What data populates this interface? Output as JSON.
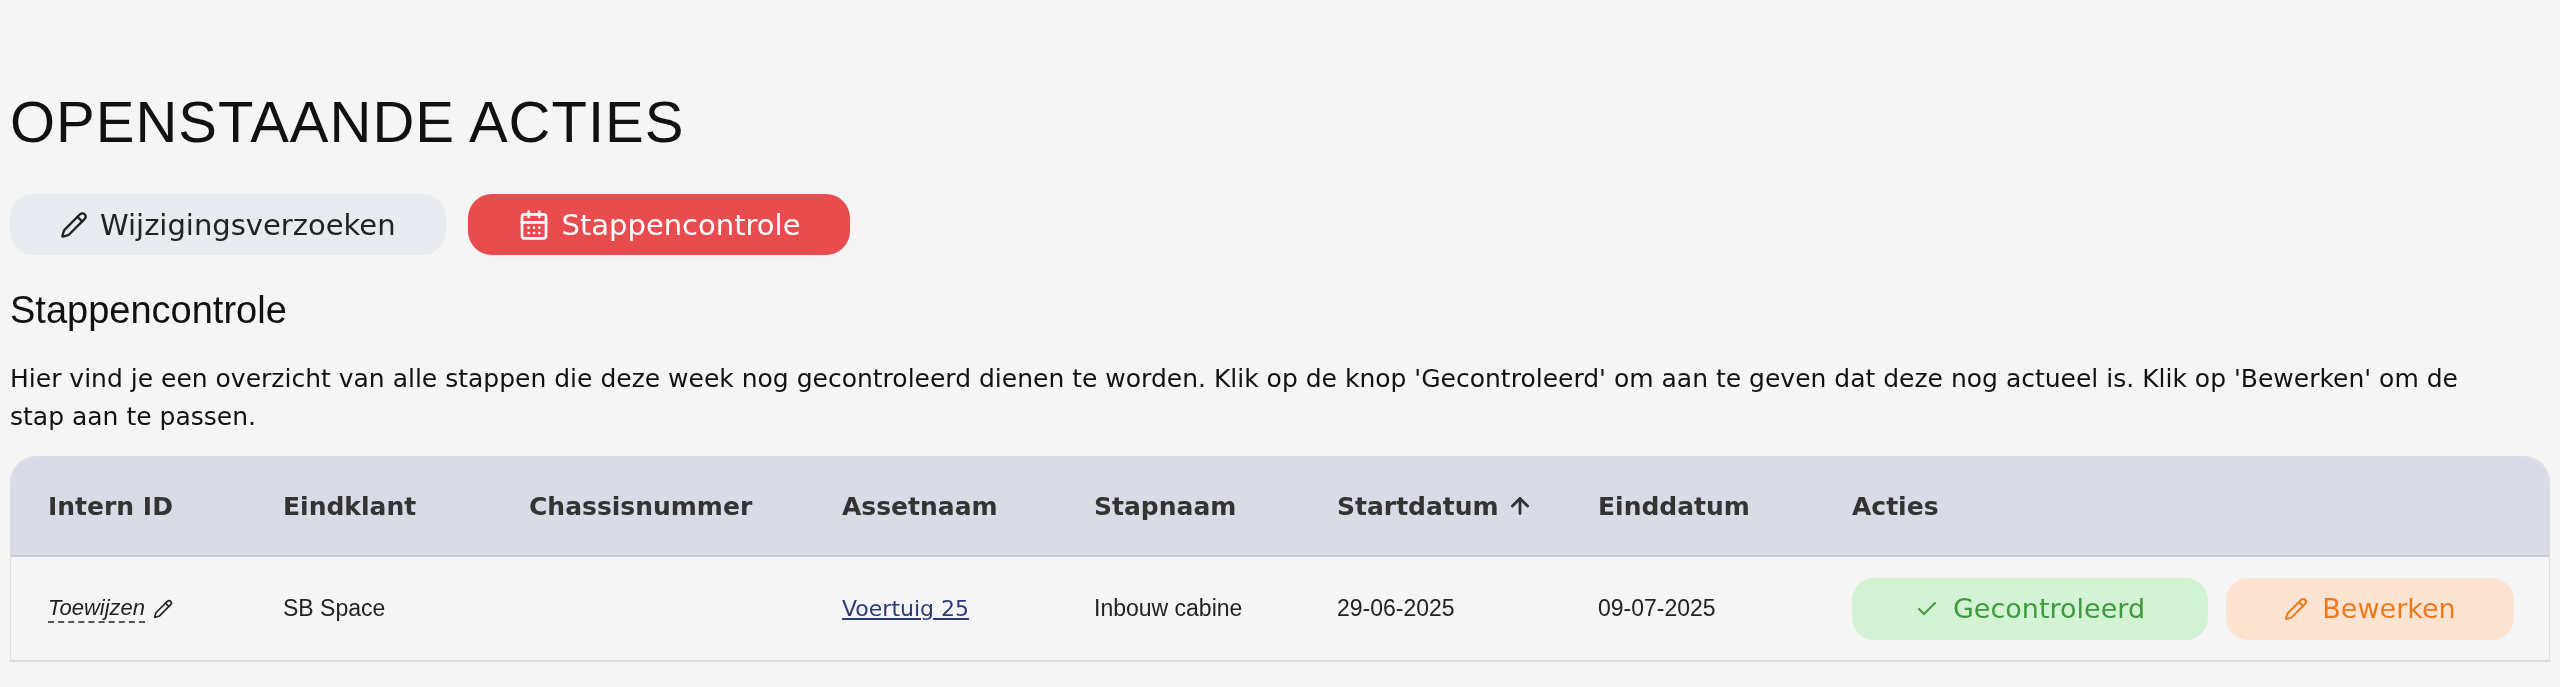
{
  "page_title": "OPENSTAANDE ACTIES",
  "tabs": [
    {
      "label": "Wijzigingsverzoeken",
      "kind": "pencil",
      "selected": false
    },
    {
      "label": "Stappencontrole",
      "kind": "calendar",
      "selected": true
    }
  ],
  "section": {
    "title": "Stappencontrole",
    "description": "Hier vind je een overzicht van alle stappen die deze week nog gecontroleerd dienen te worden. Klik op de knop 'Gecontroleerd' om aan te geven dat deze nog actueel is. Klik op 'Bewerken' om de stap aan te passen."
  },
  "table": {
    "columns": [
      {
        "label": "Intern ID",
        "sorted": false
      },
      {
        "label": "Eindklant",
        "sorted": false
      },
      {
        "label": "Chassisnummer",
        "sorted": false
      },
      {
        "label": "Assetnaam",
        "sorted": false
      },
      {
        "label": "Stapnaam",
        "sorted": false
      },
      {
        "label": "Startdatum",
        "sorted": true
      },
      {
        "label": "Einddatum",
        "sorted": false
      },
      {
        "label": "Acties",
        "sorted": false
      }
    ],
    "rows": [
      {
        "intern_id": "Toewijzen",
        "eindklant": "SB Space",
        "assetnaam": "Voertuig 25",
        "stapnaam": "Inbouw cabine",
        "startdatum": "29-06-2025",
        "einddatum": "09-07-2025",
        "actions": [
          {
            "label": "Gecontroleerd",
            "kind": "check"
          },
          {
            "label": "Bewerken",
            "kind": "edit"
          }
        ]
      }
    ]
  }
}
